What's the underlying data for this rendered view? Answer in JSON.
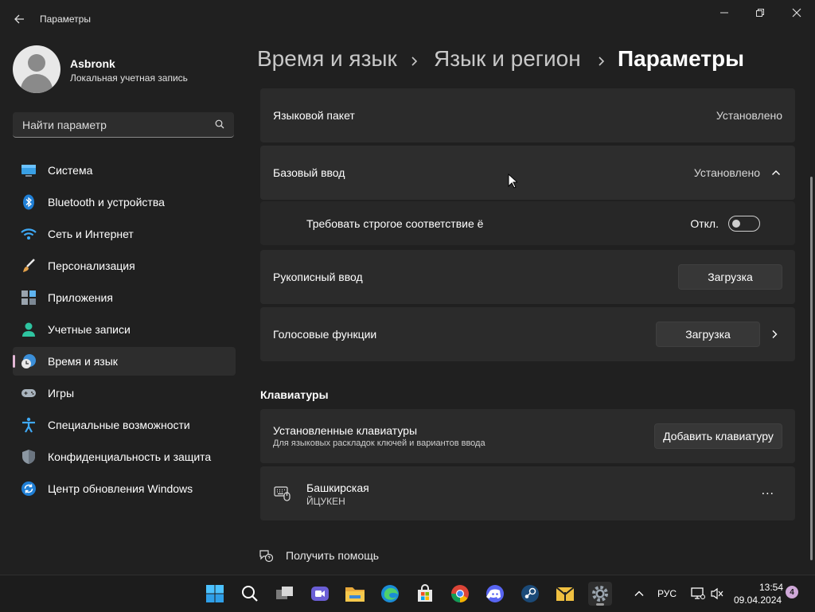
{
  "window": {
    "title": "Параметры"
  },
  "user": {
    "name": "Asbronk",
    "account_type": "Локальная учетная запись"
  },
  "search": {
    "placeholder": "Найти параметр"
  },
  "sidebar": {
    "items": [
      {
        "label": "Система",
        "icon": "monitor-icon"
      },
      {
        "label": "Bluetooth и устройства",
        "icon": "bluetooth-icon"
      },
      {
        "label": "Сеть и Интернет",
        "icon": "wifi-icon"
      },
      {
        "label": "Персонализация",
        "icon": "brush-icon"
      },
      {
        "label": "Приложения",
        "icon": "apps-icon"
      },
      {
        "label": "Учетные записи",
        "icon": "person-icon"
      },
      {
        "label": "Время и язык",
        "icon": "clock-globe-icon",
        "active": true
      },
      {
        "label": "Игры",
        "icon": "gamepad-icon"
      },
      {
        "label": "Специальные возможности",
        "icon": "accessibility-icon"
      },
      {
        "label": "Конфиденциальность и защита",
        "icon": "shield-icon"
      },
      {
        "label": "Центр обновления Windows",
        "icon": "update-icon"
      }
    ]
  },
  "breadcrumb": {
    "level1": "Время и язык",
    "level2": "Язык и регион",
    "current": "Параметры"
  },
  "main": {
    "language_pack": {
      "label": "Языковой пакет",
      "status": "Установлено"
    },
    "basic_typing": {
      "label": "Базовый ввод",
      "status": "Установлено"
    },
    "strict_yo": {
      "label": "Требовать строгое соответствие ё",
      "state": "Откл."
    },
    "handwriting": {
      "label": "Рукописный ввод",
      "button": "Загрузка"
    },
    "speech": {
      "label": "Голосовые функции",
      "button": "Загрузка"
    },
    "keyboards_section": "Клавиатуры",
    "installed_keyboards": {
      "title": "Установленные клавиатуры",
      "subtitle": "Для языковых раскладок ключей и вариантов ввода",
      "button": "Добавить клавиатуру"
    },
    "keyboard": {
      "name": "Башкирская",
      "layout": "ЙЦУКЕН",
      "more": "..."
    },
    "help_link": "Получить помощь"
  },
  "taskbar": {
    "apps": [
      "start-icon",
      "search-icon",
      "task-view-icon",
      "meet-icon",
      "file-explorer-icon",
      "edge-icon",
      "store-icon",
      "chrome-icon",
      "discord-icon",
      "steam-icon",
      "archiver-icon",
      "settings-icon"
    ],
    "language": "РУС",
    "time": "13:54",
    "date": "09.04.2024",
    "notifications": "4"
  },
  "colors": {
    "background": "#202020",
    "card": "#2b2b2b",
    "accent_indicator": "#e3b7d6",
    "taskbar": "#1c1c1c"
  }
}
